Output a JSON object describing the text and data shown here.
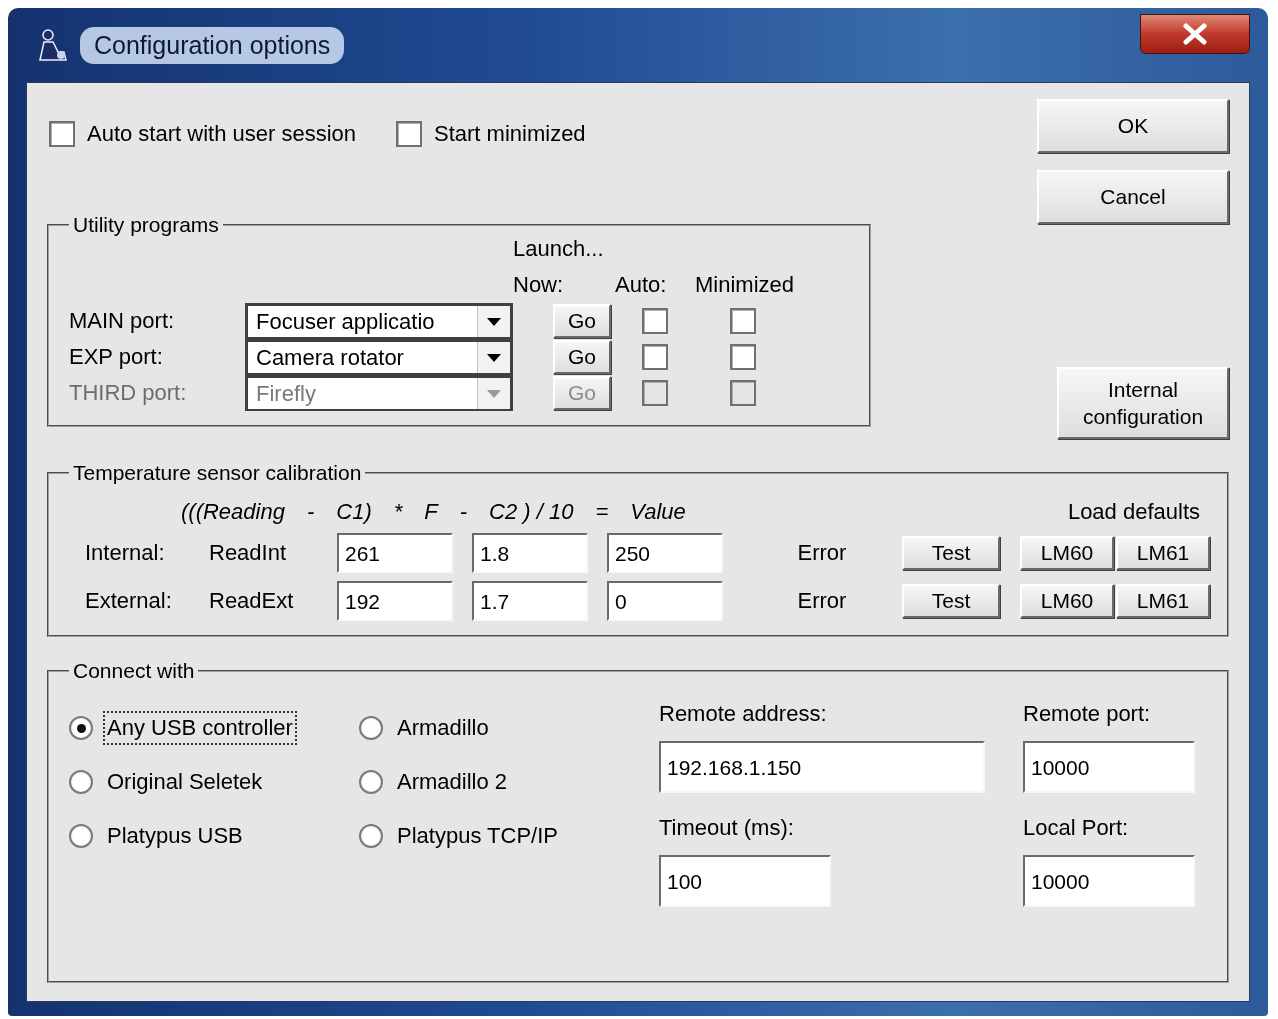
{
  "window": {
    "title": "Configuration options"
  },
  "options": [
    {
      "label": "Auto start with user session",
      "checked": false
    },
    {
      "label": "Start minimized",
      "checked": false
    }
  ],
  "buttons": {
    "ok": "OK",
    "cancel": "Cancel",
    "internal": "Internal configuration"
  },
  "utility": {
    "title": "Utility programs",
    "launch": "Launch...",
    "now": "Now:",
    "auto": "Auto:",
    "minimized": "Minimized",
    "ports": [
      {
        "label": "MAIN port:",
        "program": "Focuser applicatio",
        "go": "Go",
        "disabled": false,
        "auto": false,
        "minimized": false
      },
      {
        "label": "EXP port:",
        "program": "Camera rotator",
        "go": "Go",
        "disabled": false,
        "auto": false,
        "minimized": false
      },
      {
        "label": "THIRD port:",
        "program": "Firefly",
        "go": "Go",
        "disabled": true,
        "auto": false,
        "minimized": false
      }
    ]
  },
  "temperature": {
    "title": "Temperature sensor calibration",
    "formula": [
      "(((Reading",
      "-",
      "C1)",
      "*",
      "F",
      "-",
      "C2 ) / 10",
      "=",
      "Value"
    ],
    "load_defaults": "Load defaults",
    "rows": [
      {
        "label": "Internal:",
        "reading": "ReadInt",
        "c1": "261",
        "f": "1.8",
        "c2": "250",
        "value": "Error",
        "test": "Test",
        "defaults": [
          "LM60",
          "LM61"
        ]
      },
      {
        "label": "External:",
        "reading": "ReadExt",
        "c1": "192",
        "f": "1.7",
        "c2": "0",
        "value": "Error",
        "test": "Test",
        "defaults": [
          "LM60",
          "LM61"
        ]
      }
    ]
  },
  "connect": {
    "title": "Connect with",
    "options": [
      {
        "label": "Any USB controller",
        "selected": true,
        "focused": true
      },
      {
        "label": "Armadillo",
        "selected": false,
        "focused": false
      },
      {
        "label": "Original Seletek",
        "selected": false,
        "focused": false
      },
      {
        "label": "Armadillo 2",
        "selected": false,
        "focused": false
      },
      {
        "label": "Platypus USB",
        "selected": false,
        "focused": false
      },
      {
        "label": "Platypus TCP/IP",
        "selected": false,
        "focused": false
      }
    ],
    "remote_address": {
      "label": "Remote address:",
      "value": "192.168.1.150"
    },
    "remote_port": {
      "label": "Remote port:",
      "value": "10000"
    },
    "timeout": {
      "label": "Timeout (ms):",
      "value": "100"
    },
    "local_port": {
      "label": "Local Port:",
      "value": "10000"
    }
  }
}
